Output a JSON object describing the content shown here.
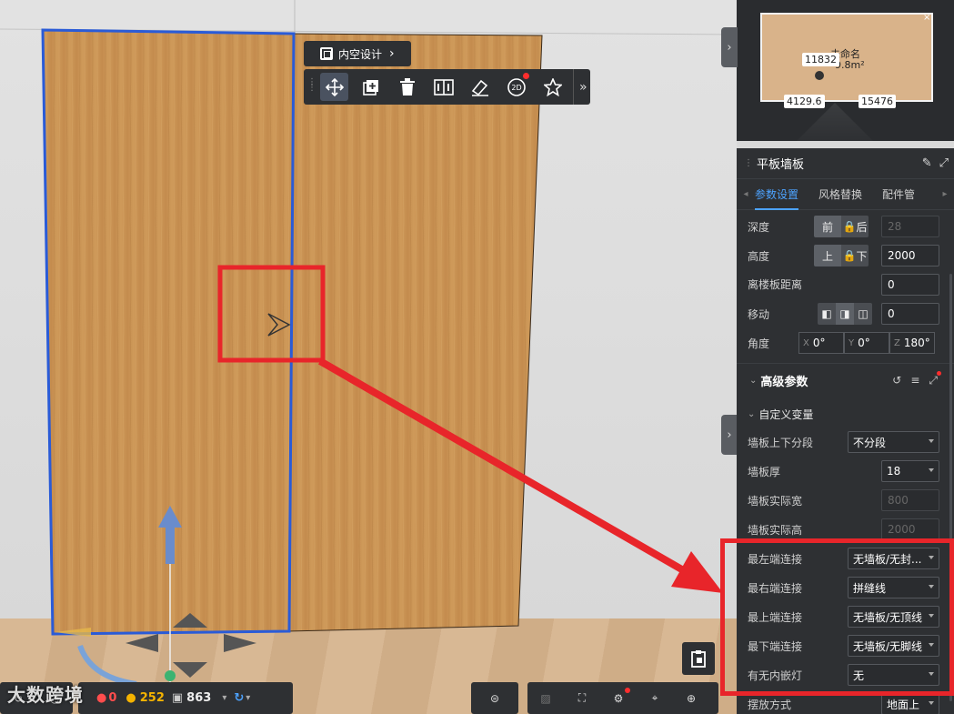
{
  "toolbar": {
    "breadcrumb_label": "内空设计",
    "buttons": [
      "move",
      "copy",
      "delete",
      "mirror",
      "paint",
      "2d-view",
      "favorite"
    ],
    "more": "»"
  },
  "minimap": {
    "room_name_partial": "未命名",
    "area_partial": "9.8m²",
    "dim_top": "11832",
    "dim_left": "4129.6",
    "dim_right": "15476"
  },
  "panel": {
    "title": "平板墙板",
    "tabs": [
      "参数设置",
      "风格替换",
      "配件管"
    ],
    "active_tab": "参数设置",
    "depth": {
      "label": "深度",
      "front": "前",
      "back": "后",
      "value": "28"
    },
    "height": {
      "label": "高度",
      "up": "上",
      "down": "下",
      "value": "2000"
    },
    "floor_distance": {
      "label": "离楼板距离",
      "value": "0"
    },
    "move": {
      "label": "移动",
      "value": "0"
    },
    "angle": {
      "label": "角度",
      "x_label": "X",
      "x": "0°",
      "y_label": "Y",
      "y": "0°",
      "z_label": "Z",
      "z": "180°"
    },
    "advanced_title": "高级参数",
    "custom_vars_title": "自定义变量",
    "fields": [
      {
        "label": "墙板上下分段",
        "value": "不分段",
        "type": "dropdown"
      },
      {
        "label": "墙板厚",
        "value": "18",
        "type": "dropdown"
      },
      {
        "label": "墙板实际宽",
        "value": "800",
        "type": "disabled"
      },
      {
        "label": "墙板实际高",
        "value": "2000",
        "type": "disabled"
      },
      {
        "label": "最左端连接",
        "value": "无墙板/无封...",
        "type": "dropdown"
      },
      {
        "label": "最右端连接",
        "value": "拼缝线",
        "type": "dropdown"
      },
      {
        "label": "最上端连接",
        "value": "无墙板/无顶线",
        "type": "dropdown"
      },
      {
        "label": "最下端连接",
        "value": "无墙板/无脚线",
        "type": "dropdown"
      },
      {
        "label": "有无内嵌灯",
        "value": "无",
        "type": "dropdown"
      },
      {
        "label": "摆放方式",
        "value": "地面上",
        "type": "dropdown"
      }
    ]
  },
  "status": {
    "watermark": "大数跨境",
    "errors": "0",
    "warnings": "252",
    "objects": "863"
  },
  "colors": {
    "accent": "#4da3ff",
    "highlight_red": "#e8252a",
    "selection_blue": "#2a5bd7",
    "wood": "#c8924f"
  }
}
